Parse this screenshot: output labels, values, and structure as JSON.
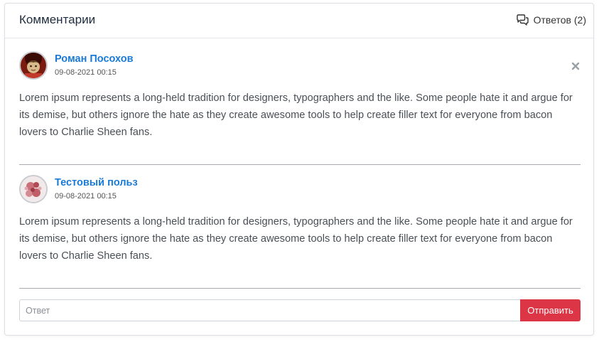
{
  "header": {
    "title": "Комментарии",
    "replies_label": "Ответов (2)"
  },
  "comments": [
    {
      "author": "Роман Посохов",
      "date": "09-08-2021 00:15",
      "text": "Lorem ipsum represents a long-held tradition for designers, typographers and the like. Some people hate it and argue for its demise, but others ignore the hate as they create awesome tools to help create filler text for everyone from bacon lovers to Charlie Sheen fans.",
      "avatar": "avatar-photo-icon",
      "can_delete": true
    },
    {
      "author": "Тестовый польз",
      "date": "09-08-2021 00:15",
      "text": "Lorem ipsum represents a long-held tradition for designers, typographers and the like. Some people hate it and argue for its demise, but others ignore the hate as they create awesome tools to help create filler text for everyone from bacon lovers to Charlie Sheen fans.",
      "avatar": "avatar-pattern-icon",
      "can_delete": false
    }
  ],
  "reply_form": {
    "placeholder": "Ответ",
    "value": "",
    "submit_label": "Отправить"
  },
  "colors": {
    "author_link": "#1a7ad6",
    "submit_button": "#dc3545"
  }
}
